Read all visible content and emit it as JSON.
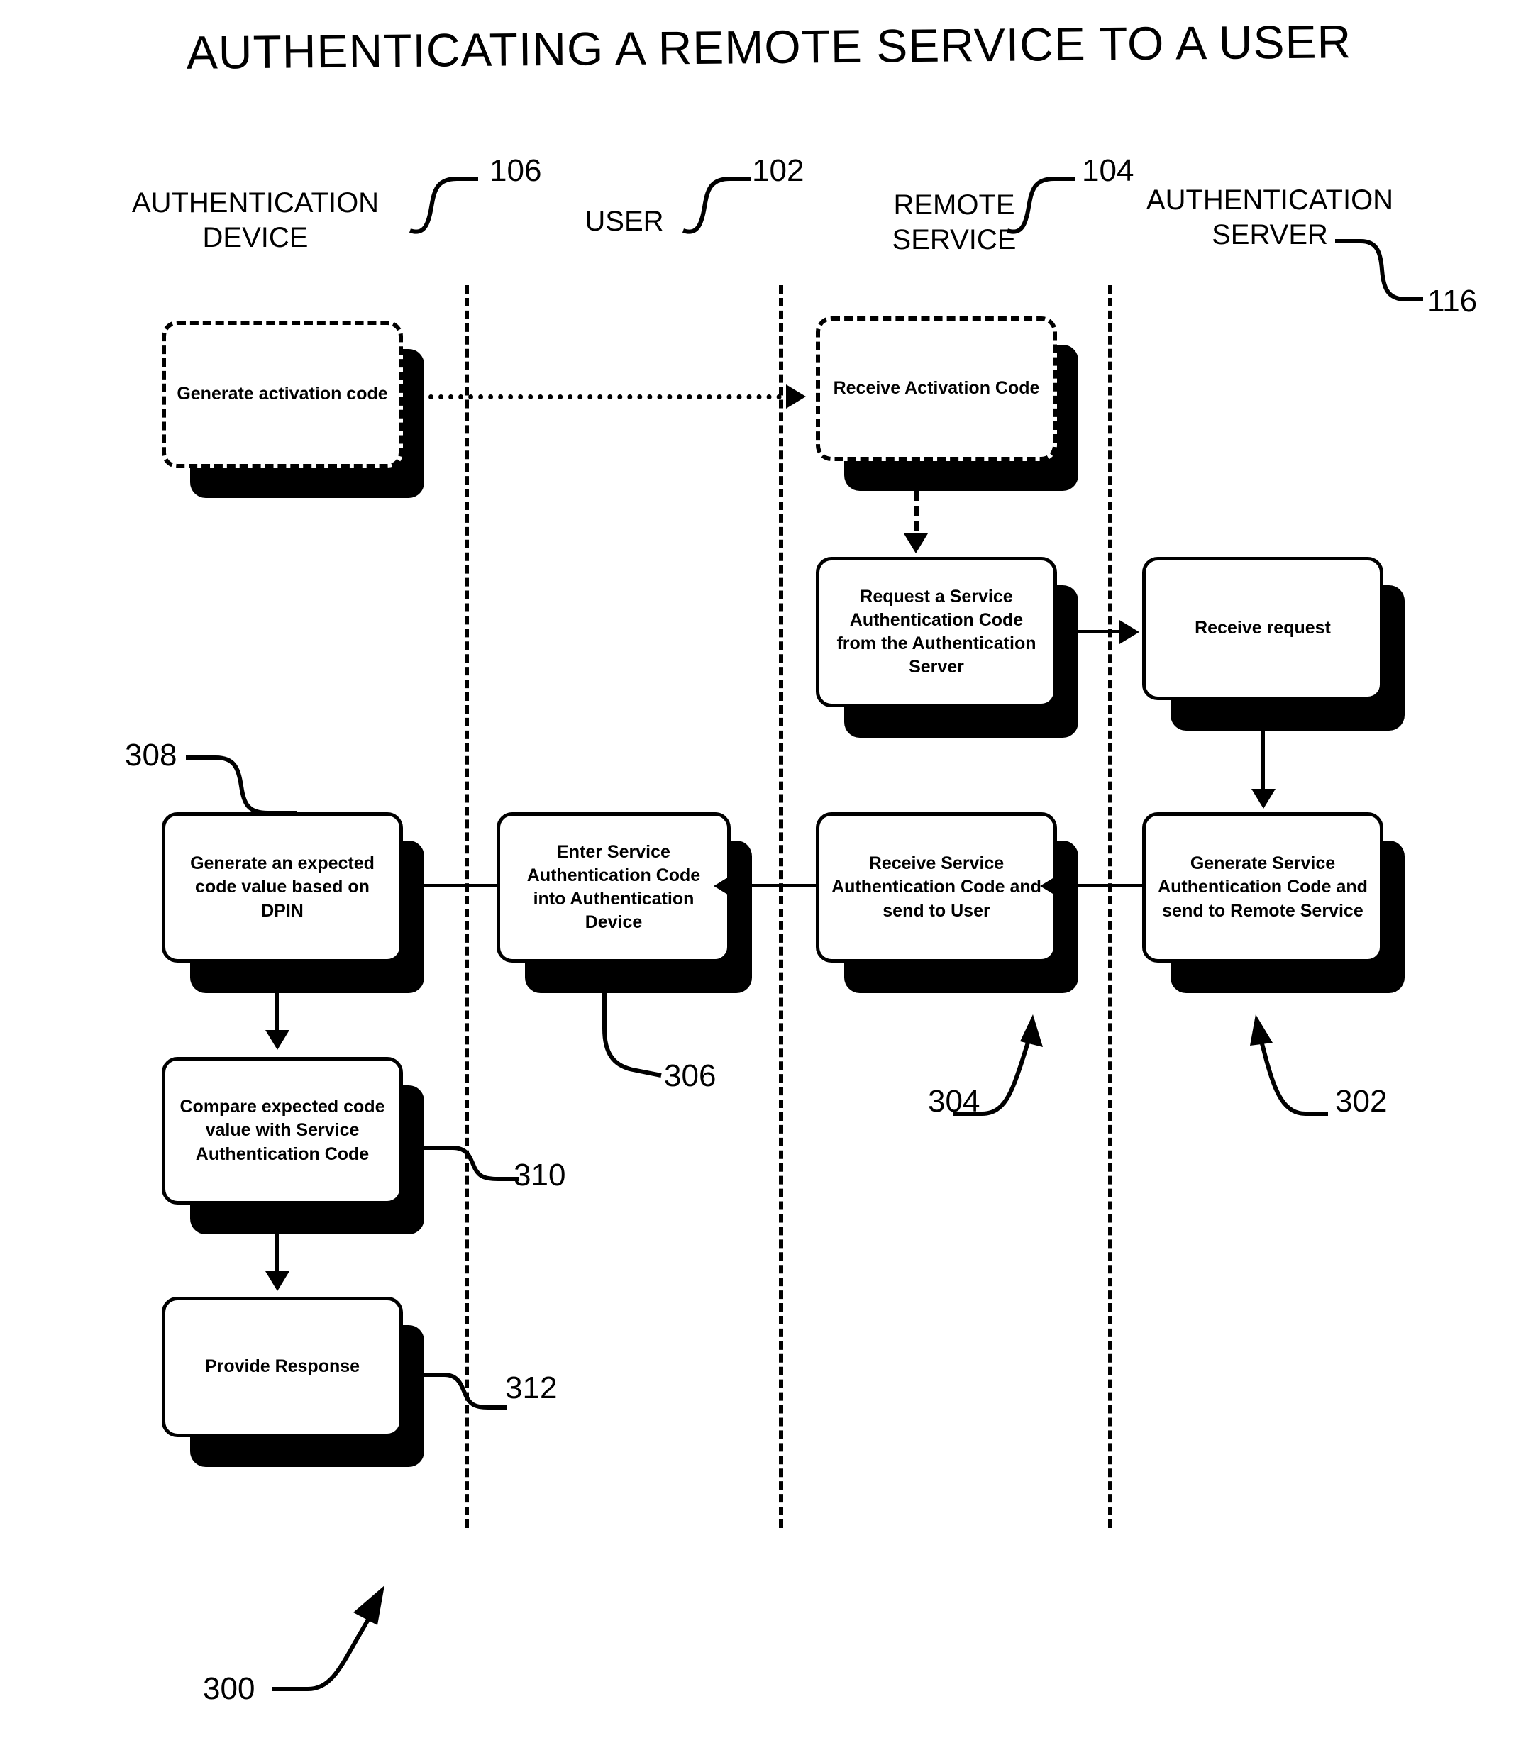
{
  "figure": {
    "title": "AUTHENTICATING A REMOTE SERVICE TO A USER",
    "figure_ref": "300"
  },
  "lanes": [
    {
      "id": "authentication-device",
      "label": "AUTHENTICATION\nDEVICE",
      "ref": "106"
    },
    {
      "id": "user",
      "label": "USER",
      "ref": "102"
    },
    {
      "id": "remote-service",
      "label": "REMOTE\nSERVICE",
      "ref": "104"
    },
    {
      "id": "authentication-server",
      "label": "AUTHENTICATION\nSERVER",
      "ref": "116"
    }
  ],
  "nodes": [
    {
      "id": "generate-activation-code",
      "lane": "authentication-device",
      "label": "Generate activation\ncode",
      "style": "dashed",
      "ref": ""
    },
    {
      "id": "receive-activation-code",
      "lane": "remote-service",
      "label": "Receive Activation\nCode",
      "style": "dashed",
      "ref": ""
    },
    {
      "id": "request-service-auth-code",
      "lane": "remote-service",
      "label": "Request a Service\nAuthentication Code\nfrom the\nAuthentication Server",
      "style": "solid",
      "ref": ""
    },
    {
      "id": "receive-request",
      "lane": "authentication-server",
      "label": "Receive  request",
      "style": "solid",
      "ref": ""
    },
    {
      "id": "generate-service-auth-code",
      "lane": "authentication-server",
      "label": "Generate Service\nAuthentication Code\nand send to Remote\nService",
      "style": "solid",
      "ref": "302"
    },
    {
      "id": "receive-service-auth-code",
      "lane": "remote-service",
      "label": "Receive Service\nAuthentication Code\nand send to User",
      "style": "solid",
      "ref": "304"
    },
    {
      "id": "enter-service-auth-code",
      "lane": "user",
      "label": "Enter Service\nAuthentication Code\ninto Authentication\nDevice",
      "style": "solid",
      "ref": "306"
    },
    {
      "id": "generate-expected-code",
      "lane": "authentication-device",
      "label": "Generate an expected\ncode value based on\nDPIN",
      "style": "solid",
      "ref": "308"
    },
    {
      "id": "compare-expected-code",
      "lane": "authentication-device",
      "label": "Compare expected\ncode value with\nService Authentication\nCode",
      "style": "solid",
      "ref": "310"
    },
    {
      "id": "provide-response",
      "lane": "authentication-device",
      "label": "Provide Response",
      "style": "solid",
      "ref": "312"
    }
  ],
  "reference_numerals": {
    "lane_106": "106",
    "lane_102": "102",
    "lane_104": "104",
    "lane_116": "116",
    "node_302": "302",
    "node_304": "304",
    "node_306": "306",
    "node_308": "308",
    "node_310": "310",
    "node_312": "312",
    "figure_300": "300"
  },
  "colors": {
    "ink": "#000000",
    "paper": "#ffffff"
  }
}
